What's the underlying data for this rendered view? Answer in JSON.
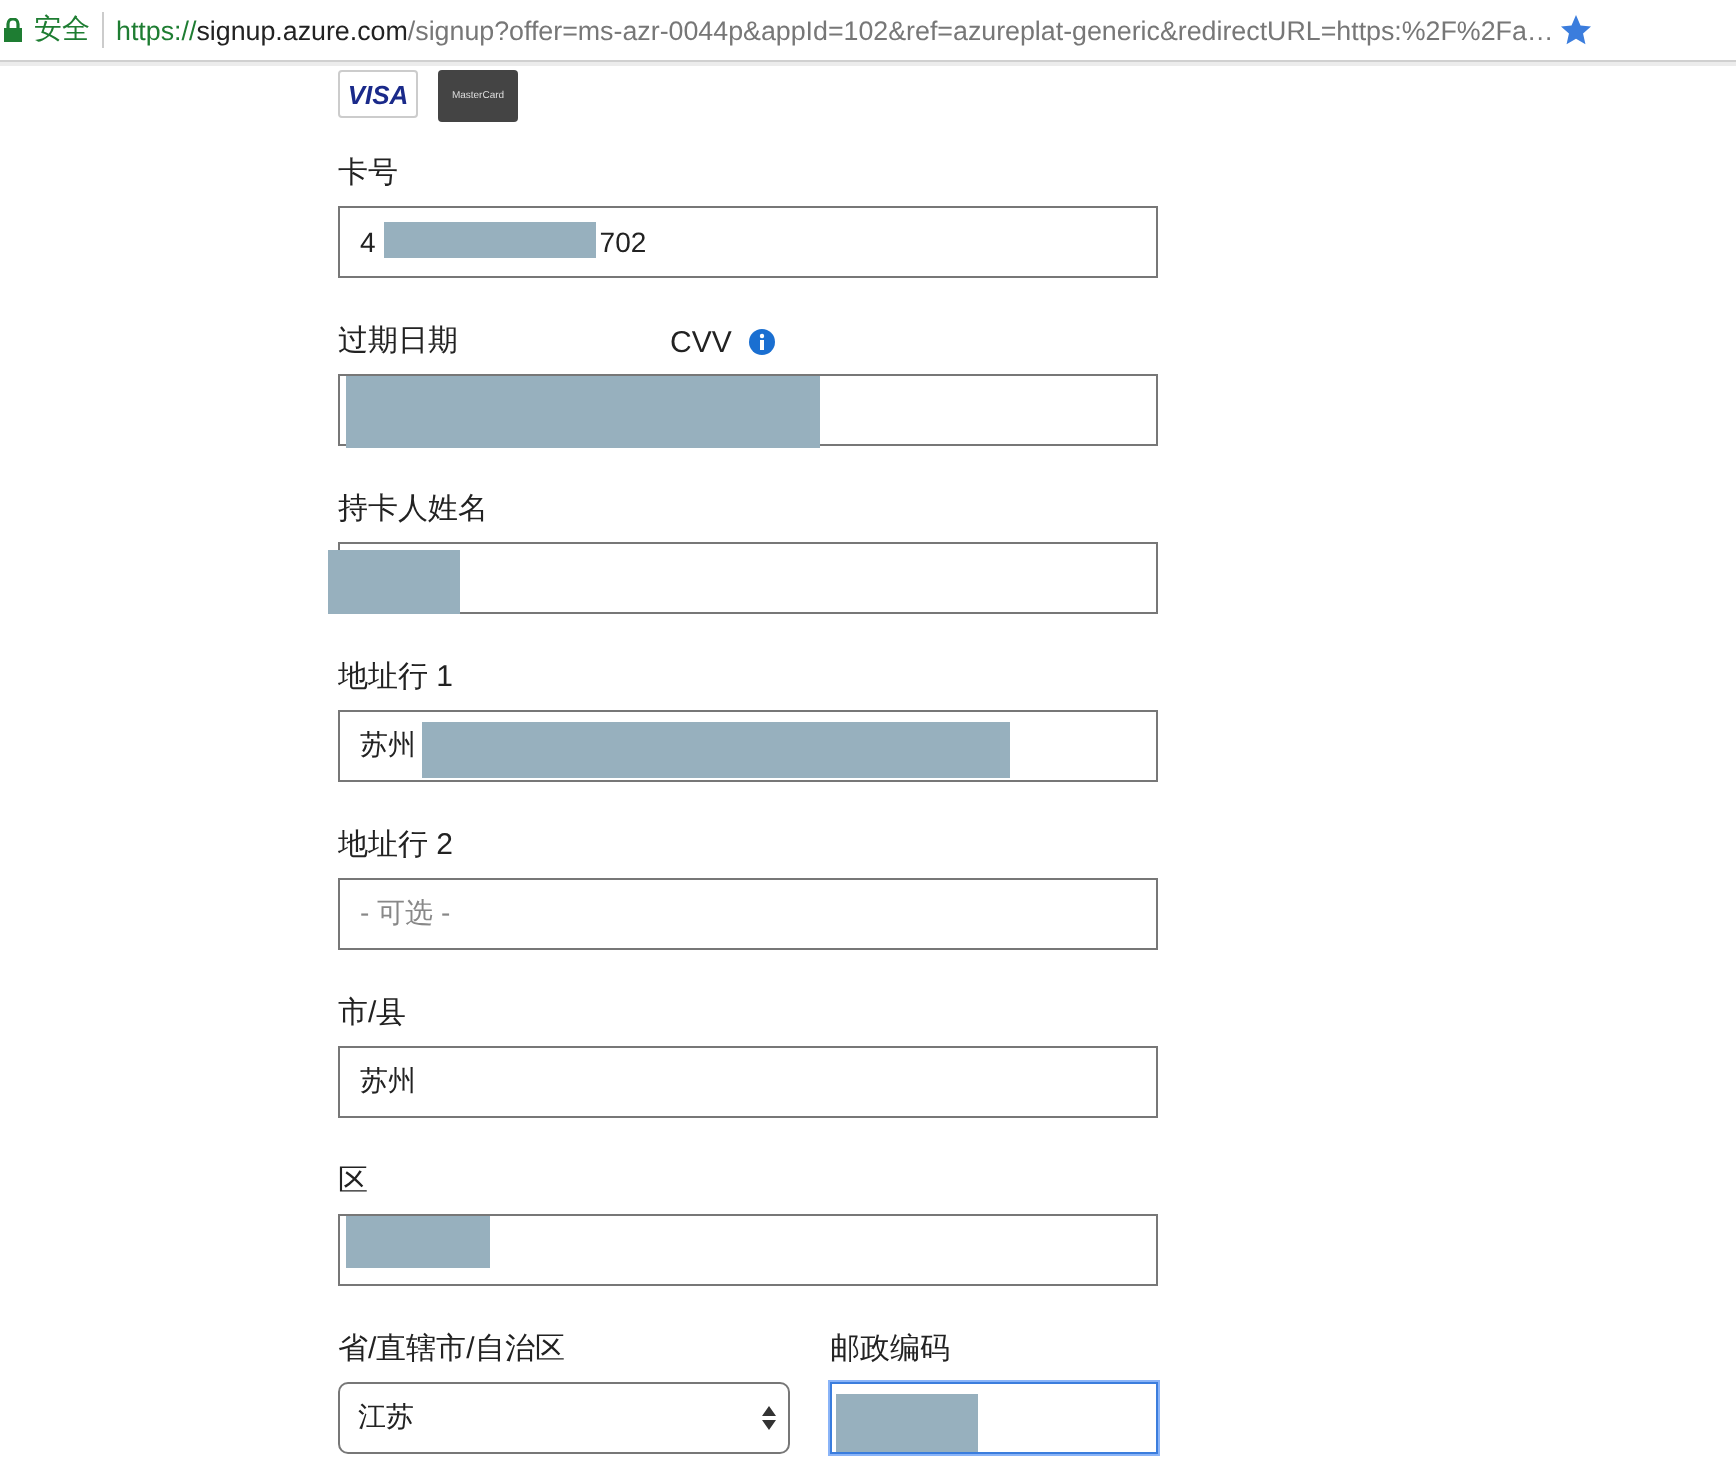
{
  "address_bar": {
    "security_label": "安全",
    "url_scheme": "https://",
    "url_host": "signup.azure.com",
    "url_rest": "/signup?offer=ms-azr-0044p&appId=102&ref=azureplat-generic&redirectURL=https:%2F%2Fa…"
  },
  "card_logos": [
    "VISA",
    "MasterCard"
  ],
  "fields": [
    {
      "kind": "text",
      "label": "卡号",
      "value": "4",
      "value_end": "702",
      "redacted": true
    },
    {
      "kind": "text",
      "label": "过期日期",
      "label_2": "CVV",
      "info": true,
      "redacted": true
    },
    {
      "kind": "text",
      "label": "持卡人姓名",
      "redacted": true
    },
    {
      "kind": "text",
      "label": "地址行 1",
      "value": "苏州",
      "redacted": true
    },
    {
      "kind": "text",
      "label": "地址行 2",
      "placeholder": "- 可选 -"
    },
    {
      "kind": "text",
      "label": "市/县",
      "value": "苏州"
    },
    {
      "kind": "text",
      "label": "区",
      "redacted": true
    }
  ],
  "bottom_row": [
    {
      "kind": "select",
      "label": "省/直辖市/自治区",
      "value": "江苏",
      "focused": false
    },
    {
      "kind": "text",
      "label": "邮政编码",
      "redacted": true,
      "focused": true
    }
  ]
}
